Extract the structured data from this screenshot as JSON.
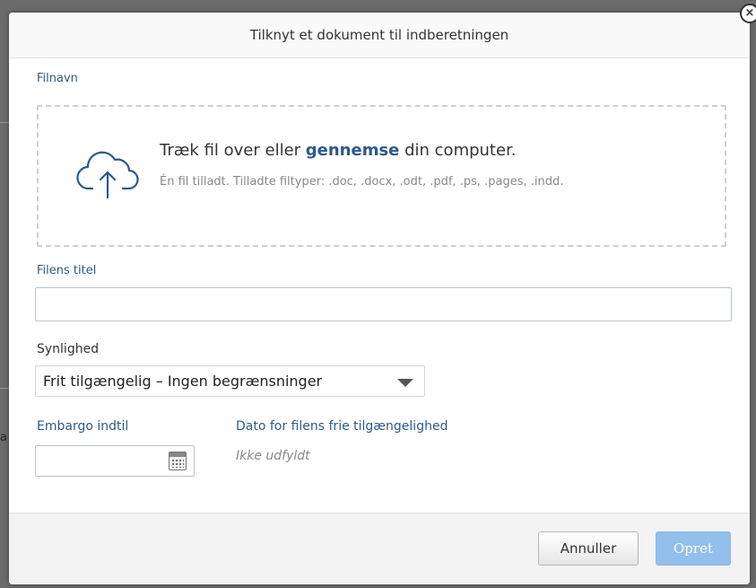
{
  "backdrop": {
    "fragment_text": "a"
  },
  "dialog": {
    "title": "Tilknyt et dokument til indberetningen",
    "close_glyph": "×",
    "file": {
      "label": "Filnavn",
      "drop_text_before": "Træk fil over eller ",
      "drop_link": "gennemse",
      "drop_text_after": " din computer.",
      "drop_hint": "Én fil tilladt. Tilladte filtyper: .doc, .docx, .odt, .pdf, .ps, .pages, .indd.",
      "icon": "cloud-upload-icon"
    },
    "title_field": {
      "label": "Filens titel",
      "value": ""
    },
    "visibility": {
      "label": "Synlighed",
      "selected": "Frit tilgængelig – Ingen begrænsninger"
    },
    "embargo": {
      "label": "Embargo indtil",
      "value": "",
      "icon": "calendar-icon"
    },
    "availability": {
      "label": "Dato for filens frie tilgængelighed",
      "value": "Ikke udfyldt"
    },
    "buttons": {
      "cancel": "Annuller",
      "create": "Opret"
    }
  },
  "colors": {
    "label_blue": "#2c5a8a",
    "primary_disabled": "#93bfec"
  }
}
